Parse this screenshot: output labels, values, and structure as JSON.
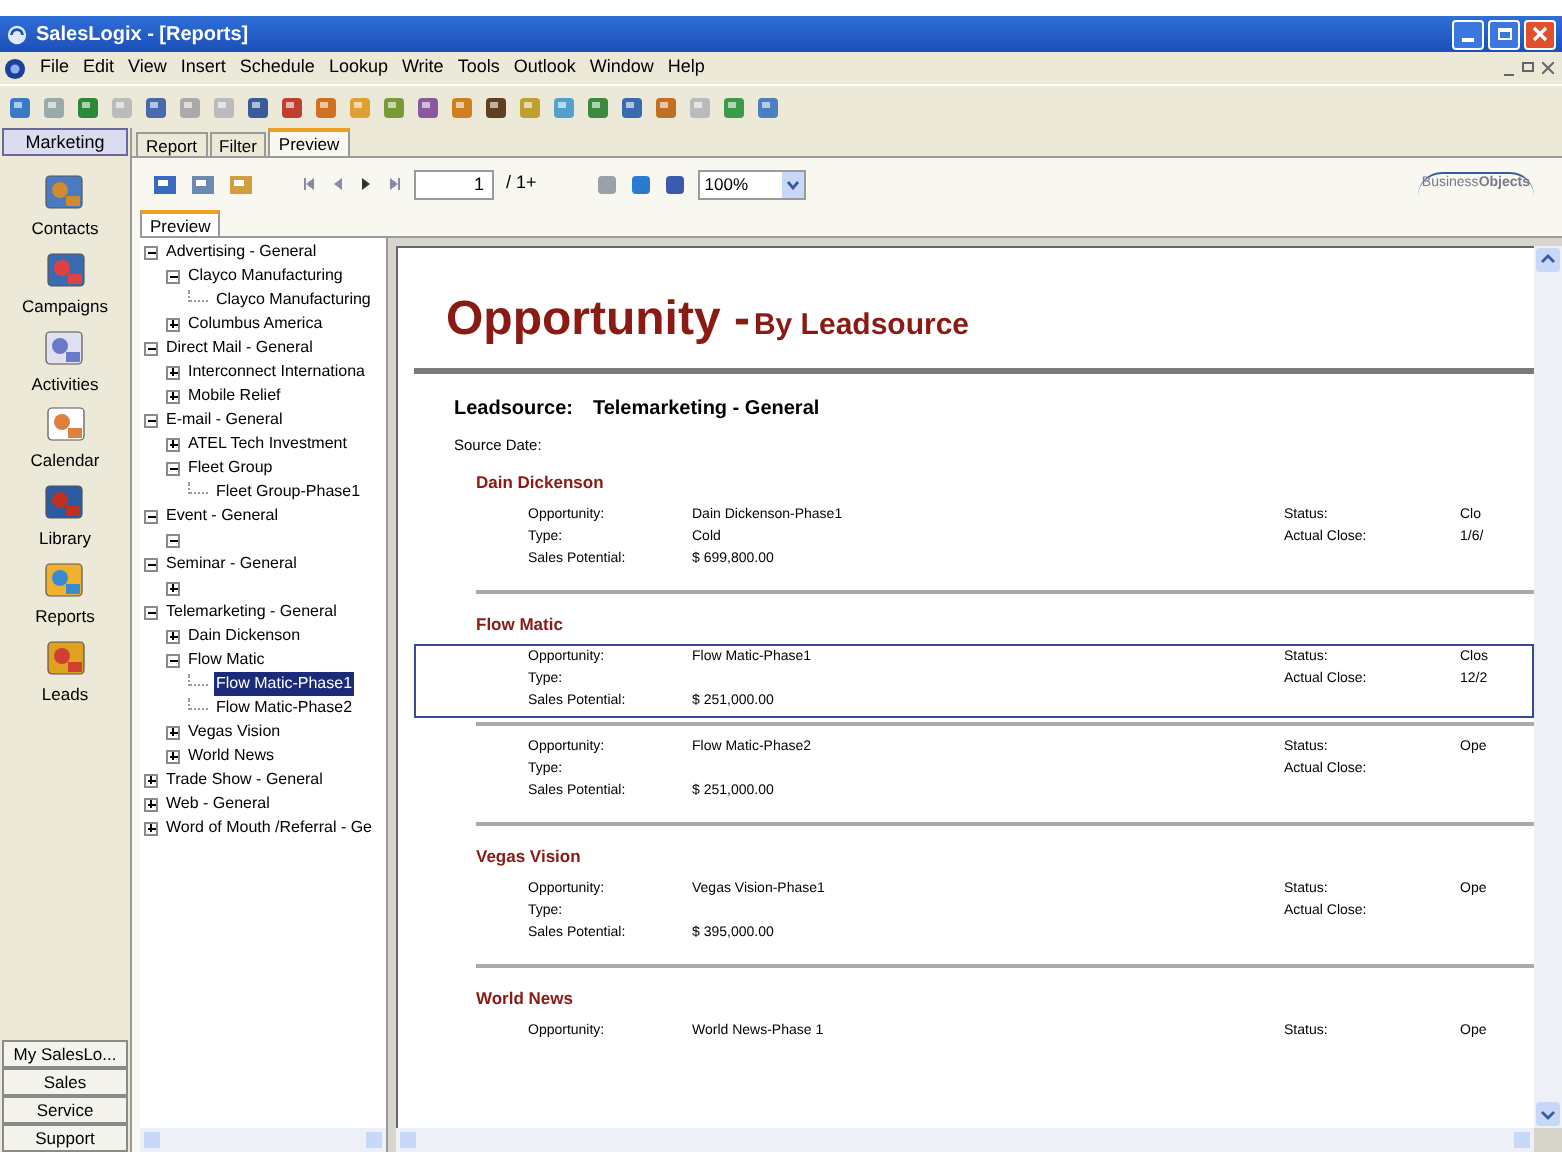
{
  "window": {
    "title": "SalesLogix - [Reports]"
  },
  "menu": [
    "File",
    "Edit",
    "View",
    "Insert",
    "Schedule",
    "Lookup",
    "Write",
    "Tools",
    "Outlook",
    "Window",
    "Help"
  ],
  "nav": {
    "group": "Marketing",
    "items": [
      {
        "label": "Contacts",
        "kind": "contacts"
      },
      {
        "label": "Campaigns",
        "kind": "campaigns"
      },
      {
        "label": "Activities",
        "kind": "activities"
      },
      {
        "label": "Calendar",
        "kind": "calendar"
      },
      {
        "label": "Library",
        "kind": "library"
      },
      {
        "label": "Reports",
        "kind": "reports"
      },
      {
        "label": "Leads",
        "kind": "leads"
      }
    ],
    "bottom_buttons": [
      "My SalesLo...",
      "Sales",
      "Service",
      "Support"
    ]
  },
  "tabs": [
    {
      "label": "Report",
      "selected": false
    },
    {
      "label": "Filter",
      "selected": false
    },
    {
      "label": "Preview",
      "selected": true
    }
  ],
  "viewer": {
    "page": "1",
    "page_total": "/ 1+",
    "zoom": "100%",
    "logo": "Business**Objects**",
    "panel_tab": "Preview"
  },
  "tree": [
    {
      "label": "Advertising - General",
      "expanded": true,
      "children": [
        {
          "label": "Clayco Manufacturing",
          "expanded": true,
          "children": [
            {
              "label": "Clayco Manufacturing"
            }
          ]
        },
        {
          "label": "Columbus America",
          "expanded": false
        }
      ]
    },
    {
      "label": "Direct Mail - General",
      "expanded": true,
      "children": [
        {
          "label": "Interconnect Internationa",
          "expanded": false
        },
        {
          "label": "Mobile Relief",
          "expanded": false
        }
      ]
    },
    {
      "label": "E-mail - General",
      "expanded": true,
      "children": [
        {
          "label": "ATEL Tech Investment",
          "expanded": false
        },
        {
          "label": "Fleet Group",
          "expanded": true,
          "children": [
            {
              "label": "Fleet Group-Phase1"
            }
          ]
        }
      ]
    },
    {
      "label": "Event - General",
      "expanded": true,
      "children": [
        {
          "expanded": true
        }
      ]
    },
    {
      "label": "Seminar - General",
      "expanded": true,
      "children": [
        {
          "expanded": false
        }
      ]
    },
    {
      "label": "Telemarketing - General",
      "expanded": true,
      "children": [
        {
          "label": "Dain Dickenson",
          "expanded": false
        },
        {
          "label": "Flow Matic",
          "expanded": true,
          "children": [
            {
              "label": "Flow Matic-Phase1",
              "selected": true
            },
            {
              "label": "Flow Matic-Phase2",
              "selected": false
            }
          ]
        },
        {
          "label": "Vegas Vision",
          "expanded": false
        },
        {
          "label": "World News",
          "expanded": false
        }
      ]
    },
    {
      "label": "Trade Show - General",
      "expanded": false
    },
    {
      "label": "Web - General",
      "expanded": false
    },
    {
      "label": "Word of Mouth /Referral - Ge",
      "expanded": false
    }
  ],
  "report": {
    "title": "Opportunity - ",
    "subtitle": "By Leadsource",
    "leadsource_label": "Leadsource:",
    "leadsource": "Telemarketing - General",
    "source_date": "Source Date:",
    "groups": [
      {
        "name": "Dain Dickenson",
        "records": [
          {
            "selected": false,
            "rows": [
              {
                "label": "Opportunity:",
                "value": "Dain Dickenson-Phase1",
                "label_2": "Status:",
                "value_2": "Clo"
              },
              {
                "label": "Type:",
                "value": "Cold",
                "label_2": "Actual Close:",
                "value_2": "1/6/"
              },
              {
                "label": "Sales Potential:",
                "value": "$ 699,800.00"
              }
            ]
          }
        ]
      },
      {
        "name": "Flow Matic",
        "records": [
          {
            "selected": true,
            "rows": [
              {
                "label": "Opportunity:",
                "value": "Flow Matic-Phase1",
                "label_2": "Status:",
                "value_2": "Clos"
              },
              {
                "label": "Type:",
                "label_2": "Actual Close:",
                "value_2": "12/2"
              },
              {
                "label": "Sales Potential:",
                "value": "$ 251,000.00"
              }
            ]
          },
          {
            "selected": false,
            "rows": [
              {
                "label": "Opportunity:",
                "value": "Flow Matic-Phase2",
                "label_2": "Status:",
                "value_2": "Ope"
              },
              {
                "label": "Type:",
                "label_2": "Actual Close:"
              },
              {
                "label": "Sales Potential:",
                "value": "$ 251,000.00"
              }
            ]
          }
        ]
      },
      {
        "name": "Vegas Vision",
        "records": [
          {
            "selected": false,
            "rows": [
              {
                "label": "Opportunity:",
                "value": "Vegas Vision-Phase1",
                "label_2": "Status:",
                "value_2": "Ope"
              },
              {
                "label": "Type:",
                "label_2": "Actual Close:"
              },
              {
                "label": "Sales Potential:",
                "value": "$ 395,000.00"
              }
            ]
          }
        ]
      },
      {
        "name": "World News",
        "records": [
          {
            "selected": false,
            "rows": [
              {
                "label": "Opportunity:",
                "value": "World News-Phase 1",
                "label_2": "Status:",
                "value_2": "Ope"
              }
            ]
          }
        ]
      }
    ]
  }
}
